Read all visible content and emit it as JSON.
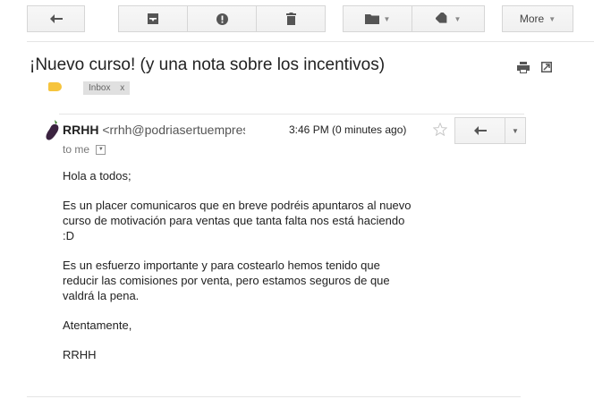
{
  "toolbar": {
    "more_label": "More",
    "icons": [
      "back-arrow-icon",
      "archive-icon",
      "report-spam-icon",
      "delete-icon",
      "folder-icon",
      "label-icon"
    ]
  },
  "email": {
    "subject": "¡Nuevo curso! (y una nota sobre los incentivos)",
    "label_chip": "Inbox",
    "label_chip_close": "x",
    "sender_name": "RRHH",
    "sender_email": "<rrhh@podriasertuempresa>",
    "timestamp": "3:46 PM (0 minutes ago)",
    "recipient": "to me",
    "body": {
      "greeting": "Hola a todos;",
      "paragraph1_line1": "Es un placer comunicaros que en breve podréis apuntaros al nuevo",
      "paragraph1_line2": "curso de motivación para ventas que tanta falta nos está haciendo",
      "paragraph1_line3": ":D",
      "paragraph2_line1": "Es un esfuerzo importante y para costearlo hemos tenido que",
      "paragraph2_line2": "reducir las comisiones por venta, pero estamos seguros de que",
      "paragraph2_line3": "valdrá la pena.",
      "closing": "Atentamente,",
      "signature": "RRHH"
    }
  },
  "colors": {
    "label_tag": "#f6c43d",
    "border": "#d6d6d6",
    "text": "#222222"
  }
}
